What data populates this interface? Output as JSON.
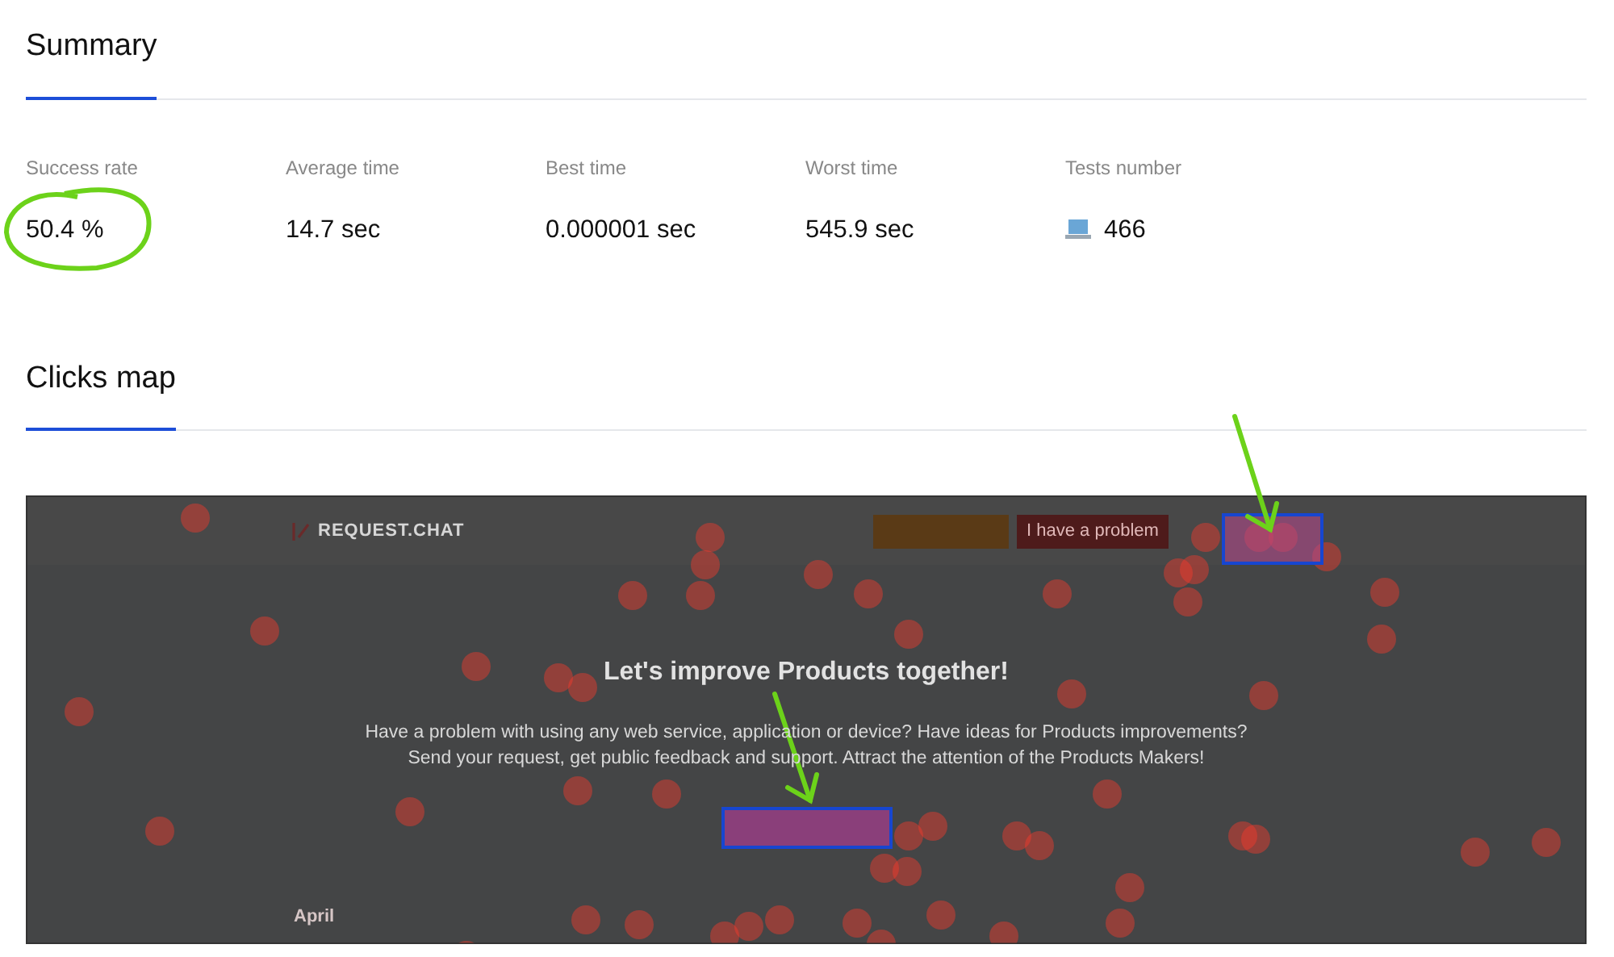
{
  "summary": {
    "title": "Summary",
    "stats": [
      {
        "label": "Success rate",
        "value": "50.4 %",
        "kind": "plain"
      },
      {
        "label": "Average time",
        "value": "14.7 sec",
        "kind": "plain"
      },
      {
        "label": "Best time",
        "value": "0.000001 sec",
        "kind": "plain"
      },
      {
        "label": "Worst time",
        "value": "545.9 sec",
        "kind": "plain"
      },
      {
        "label": "Tests number",
        "value": "466",
        "kind": "device"
      }
    ]
  },
  "clicks_map": {
    "title": "Clicks map",
    "screenshot": {
      "logo": "REQUEST.CHAT",
      "header_button": "I have a problem",
      "heading": "Let's improve Products together!",
      "description_lines": [
        "Have a problem with using any web service, application or device? Have ideas for Products improvements?",
        "Send your request, get public feedback and support. Attract the attention of the Products Makers!"
      ],
      "month": "April"
    }
  }
}
